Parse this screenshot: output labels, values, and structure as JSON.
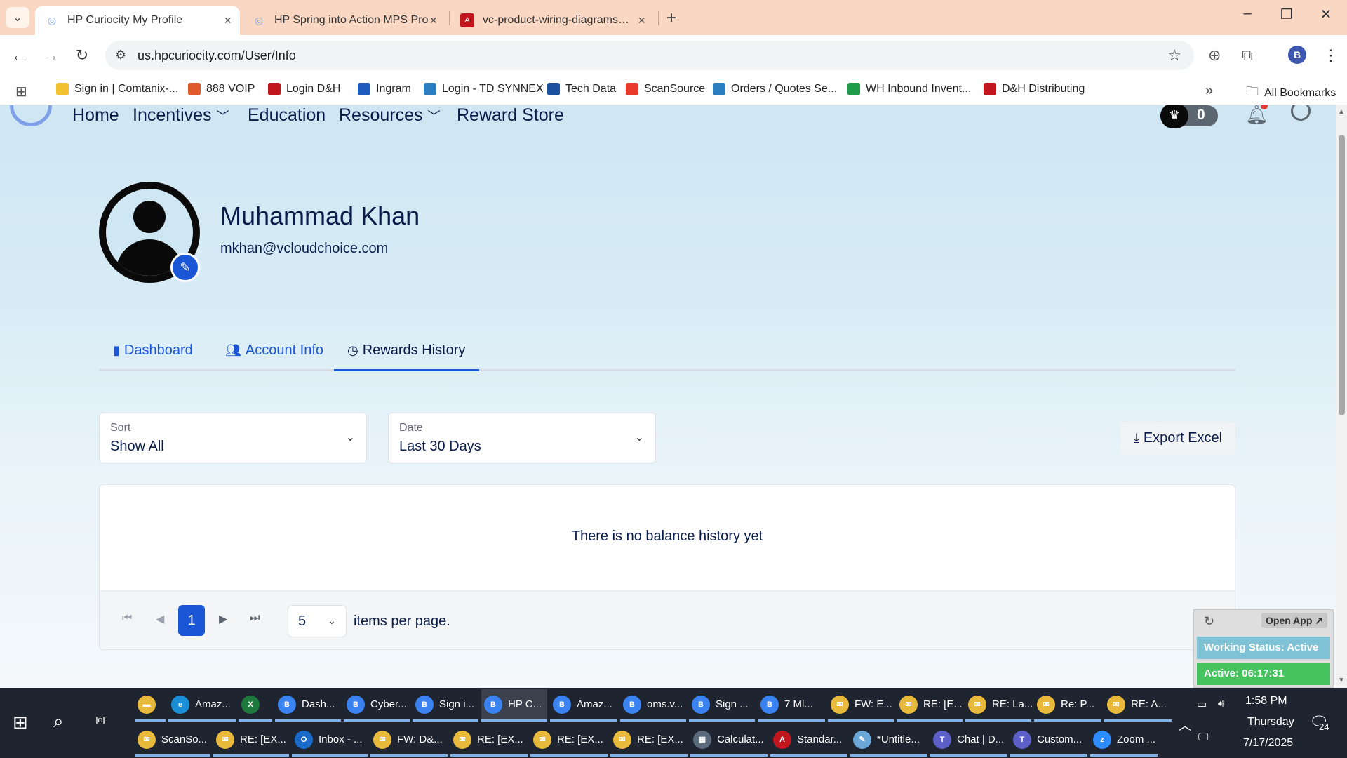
{
  "browser": {
    "tabs": [
      {
        "title": "HP Curiocity My Profile",
        "active": true
      },
      {
        "title": "HP Spring into Action MPS Pro",
        "active": false
      },
      {
        "title": "vc-product-wiring-diagrams.pd",
        "active": false
      }
    ],
    "url": "us.hpcuriocity.com/User/Info",
    "profile_initial": "B",
    "bookmarks": [
      {
        "label": "Sign in | Comtanix-...",
        "color": "#f2c230"
      },
      {
        "label": "888 VOIP",
        "color": "#e05a2b"
      },
      {
        "label": "Login D&H",
        "color": "#c2161e"
      },
      {
        "label": "Ingram",
        "color": "#1e5bbf"
      },
      {
        "label": "Login - TD SYNNEX",
        "color": "#2b7fc1"
      },
      {
        "label": "Tech Data",
        "color": "#1b4fa0"
      },
      {
        "label": "ScanSource",
        "color": "#e63b2a"
      },
      {
        "label": "Orders / Quotes Se...",
        "color": "#2b7fc1"
      },
      {
        "label": "WH Inbound Invent...",
        "color": "#1f9c4a"
      },
      {
        "label": "D&H Distributing",
        "color": "#c2161e"
      }
    ],
    "bookmarks_more": "»",
    "all_bookmarks": "All Bookmarks"
  },
  "site_nav": {
    "items": [
      "Home",
      "Incentives",
      "Education",
      "Resources",
      "Reward Store"
    ],
    "points": "0"
  },
  "profile": {
    "name": "Muhammad Khan",
    "email": "mkhan@vcloudchoice.com"
  },
  "profile_tabs": {
    "dashboard": "Dashboard",
    "account_info": "Account Info",
    "rewards_history": "Rewards History"
  },
  "filters": {
    "sort_label": "Sort",
    "sort_value": "Show All",
    "date_label": "Date",
    "date_value": "Last 30 Days",
    "export_label": "Export Excel"
  },
  "history": {
    "empty_message": "There is no balance history yet",
    "current_page": "1",
    "page_size": "5",
    "per_page_label": "items per page."
  },
  "widget": {
    "open_app": "Open App ↗",
    "working_status": "Working Status: Active",
    "active_time": "Active: 06:17:31"
  },
  "taskbar": {
    "row1": [
      {
        "label": "",
        "color": "#e8b93a",
        "ic": "▬"
      },
      {
        "label": "Amaz...",
        "color": "#1a8fd8",
        "ic": "e"
      },
      {
        "label": "",
        "color": "#1e7a3c",
        "ic": "X"
      },
      {
        "label": "Dash...",
        "color": "#3a82f0",
        "ic": "B"
      },
      {
        "label": "Cyber...",
        "color": "#3a82f0",
        "ic": "B"
      },
      {
        "label": "Sign i...",
        "color": "#3a82f0",
        "ic": "B"
      },
      {
        "label": "HP C...",
        "color": "#3a82f0",
        "ic": "B"
      },
      {
        "label": "Amaz...",
        "color": "#3a82f0",
        "ic": "B"
      },
      {
        "label": "oms.v...",
        "color": "#3a82f0",
        "ic": "B"
      },
      {
        "label": "Sign ...",
        "color": "#3a82f0",
        "ic": "B"
      },
      {
        "label": "7 Ml...",
        "color": "#3a82f0",
        "ic": "B"
      },
      {
        "label": "FW: E...",
        "color": "#e8b93a",
        "ic": "✉"
      },
      {
        "label": "RE: [E...",
        "color": "#e8b93a",
        "ic": "✉"
      },
      {
        "label": "RE: La...",
        "color": "#e8b93a",
        "ic": "✉"
      },
      {
        "label": "Re: P...",
        "color": "#e8b93a",
        "ic": "✉"
      },
      {
        "label": "RE: A...",
        "color": "#e8b93a",
        "ic": "✉"
      }
    ],
    "row2": [
      {
        "label": "ScanSo...",
        "color": "#e8b93a",
        "ic": "✉"
      },
      {
        "label": "RE: [EX...",
        "color": "#e8b93a",
        "ic": "✉"
      },
      {
        "label": "Inbox - ...",
        "color": "#1a6ac9",
        "ic": "O"
      },
      {
        "label": "FW: D&...",
        "color": "#e8b93a",
        "ic": "✉"
      },
      {
        "label": "RE: [EX...",
        "color": "#e8b93a",
        "ic": "✉"
      },
      {
        "label": "RE: [EX...",
        "color": "#e8b93a",
        "ic": "✉"
      },
      {
        "label": "RE: [EX...",
        "color": "#e8b93a",
        "ic": "✉"
      },
      {
        "label": "Calculat...",
        "color": "#5a6a7a",
        "ic": "▦"
      },
      {
        "label": "Standar...",
        "color": "#c2161e",
        "ic": "A"
      },
      {
        "label": "*Untitle...",
        "color": "#6aa6d8",
        "ic": "✎"
      },
      {
        "label": "Chat | D...",
        "color": "#5b5fc7",
        "ic": "T"
      },
      {
        "label": "Custom...",
        "color": "#5b5fc7",
        "ic": "T"
      },
      {
        "label": "Zoom ...",
        "color": "#2d8cff",
        "ic": "z"
      }
    ],
    "time": "1:58 PM",
    "day": "Thursday",
    "date": "7/17/2025",
    "notifications": "24"
  }
}
